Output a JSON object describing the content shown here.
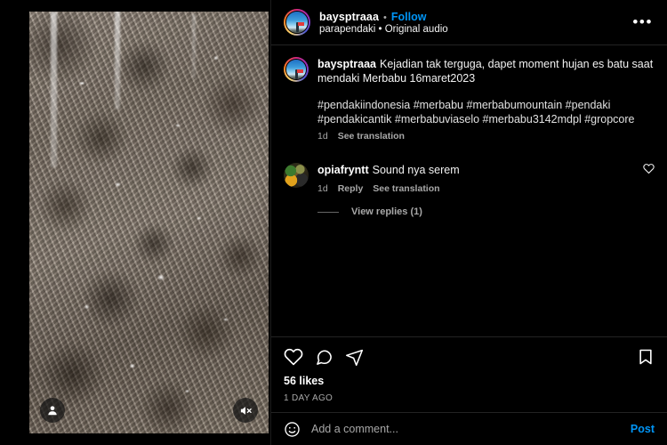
{
  "post": {
    "header": {
      "username": "baysptraaa",
      "separator": "•",
      "follow_label": "Follow",
      "audio_line": "parapendaki • Original audio",
      "more_label": "•••",
      "avatar_icon": "story-ring-avatar",
      "more_icon": "more-options-icon"
    },
    "media": {
      "tag_icon": "person-tag-icon",
      "mute_icon": "audio-muted-icon"
    },
    "caption": {
      "username": "baysptraaa",
      "text": "Kejadian tak terguga, dapet moment hujan es batu saat mendaki Merbabu 16maret2023",
      "hashtags": "#pendakiindonesia #merbabu #merbabumountain #pendaki #pendakicantik #merbabuviaselo #merbabu3142mdpl #gropcore",
      "time": "1d",
      "translate_label": "See translation"
    },
    "comments": [
      {
        "username": "opiafryntt",
        "text": "Sound nya serem",
        "time": "1d",
        "reply_label": "Reply",
        "translate_label": "See translation",
        "like_icon": "heart-outline-icon",
        "avatar_icon": "commenter-avatar",
        "view_replies_label": "View replies (1)"
      }
    ],
    "actions": {
      "like_icon": "heart-outline-icon",
      "comment_icon": "comment-bubble-icon",
      "share_icon": "share-paperplane-icon",
      "save_icon": "bookmark-outline-icon",
      "likes_count": "56 likes",
      "timestamp": "1 DAY AGO"
    },
    "composer": {
      "emoji_icon": "emoji-smiley-icon",
      "placeholder": "Add a comment...",
      "post_label": "Post"
    },
    "colors": {
      "background": "#000000",
      "link_blue": "#0095f6",
      "secondary_text": "#a8a8a8",
      "primary_text": "#f2f2f2",
      "divider": "#232323"
    }
  }
}
